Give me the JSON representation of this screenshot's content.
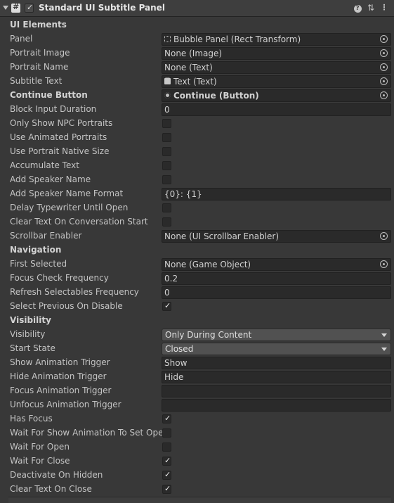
{
  "header": {
    "title": "Standard UI Subtitle Panel",
    "help_icon": "?",
    "presets_icon": "⇅",
    "more_icon": "⋮",
    "enabled": true
  },
  "sections": {
    "ui_elements": "UI Elements",
    "navigation": "Navigation",
    "visibility": "Visibility"
  },
  "fields": {
    "panel": {
      "label": "Panel",
      "value": "Bubble Panel (Rect Transform)"
    },
    "portrait_image": {
      "label": "Portrait Image",
      "value": "None (Image)"
    },
    "portrait_name": {
      "label": "Portrait Name",
      "value": "None (Text)"
    },
    "subtitle_text": {
      "label": "Subtitle Text",
      "value": "Text (Text)"
    },
    "continue_button": {
      "label": "Continue Button",
      "value": "Continue (Button)"
    },
    "block_input_duration": {
      "label": "Block Input Duration",
      "value": "0"
    },
    "only_show_npc_portraits": {
      "label": "Only Show NPC Portraits",
      "checked": false
    },
    "use_animated_portraits": {
      "label": "Use Animated Portraits",
      "checked": false
    },
    "use_portrait_native_size": {
      "label": "Use Portrait Native Size",
      "checked": false
    },
    "accumulate_text": {
      "label": "Accumulate Text",
      "checked": false
    },
    "add_speaker_name": {
      "label": "Add Speaker Name",
      "checked": false
    },
    "add_speaker_name_format": {
      "label": "Add Speaker Name Format",
      "value": "{0}: {1}"
    },
    "delay_typewriter_until_open": {
      "label": "Delay Typewriter Until Open",
      "checked": false
    },
    "clear_text_on_conversation_start": {
      "label": "Clear Text On Conversation Start",
      "checked": false
    },
    "scrollbar_enabler": {
      "label": "Scrollbar Enabler",
      "value": "None (UI Scrollbar Enabler)"
    },
    "first_selected": {
      "label": "First Selected",
      "value": "None (Game Object)"
    },
    "focus_check_frequency": {
      "label": "Focus Check Frequency",
      "value": "0.2"
    },
    "refresh_selectables_frequency": {
      "label": "Refresh Selectables Frequency",
      "value": "0"
    },
    "select_previous_on_disable": {
      "label": "Select Previous On Disable",
      "checked": true
    },
    "visibility": {
      "label": "Visibility",
      "value": "Only During Content"
    },
    "start_state": {
      "label": "Start State",
      "value": "Closed"
    },
    "show_animation_trigger": {
      "label": "Show Animation Trigger",
      "value": "Show"
    },
    "hide_animation_trigger": {
      "label": "Hide Animation Trigger",
      "value": "Hide"
    },
    "focus_animation_trigger": {
      "label": "Focus Animation Trigger",
      "value": ""
    },
    "unfocus_animation_trigger": {
      "label": "Unfocus Animation Trigger",
      "value": ""
    },
    "has_focus": {
      "label": "Has Focus",
      "checked": true
    },
    "wait_for_show_animation_to_set_open": {
      "label": "Wait For Show Animation To Set Open",
      "checked": false
    },
    "wait_for_open": {
      "label": "Wait For Open",
      "checked": false
    },
    "wait_for_close": {
      "label": "Wait For Close",
      "checked": true
    },
    "deactivate_on_hidden": {
      "label": "Deactivate On Hidden",
      "checked": true
    },
    "clear_text_on_close": {
      "label": "Clear Text On Close",
      "checked": true
    }
  },
  "check_glyph": "✓"
}
